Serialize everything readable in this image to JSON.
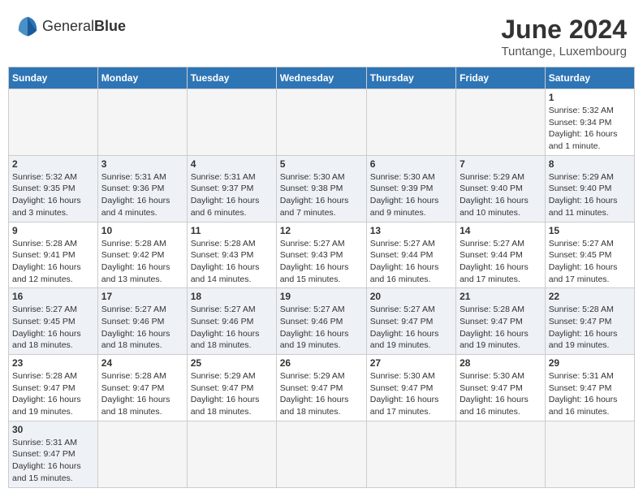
{
  "header": {
    "logo_text_normal": "General",
    "logo_text_bold": "Blue",
    "month_year": "June 2024",
    "location": "Tuntange, Luxembourg"
  },
  "weekdays": [
    "Sunday",
    "Monday",
    "Tuesday",
    "Wednesday",
    "Thursday",
    "Friday",
    "Saturday"
  ],
  "weeks": [
    {
      "days": [
        {
          "number": "",
          "info": "",
          "empty": true
        },
        {
          "number": "",
          "info": "",
          "empty": true
        },
        {
          "number": "",
          "info": "",
          "empty": true
        },
        {
          "number": "",
          "info": "",
          "empty": true
        },
        {
          "number": "",
          "info": "",
          "empty": true
        },
        {
          "number": "",
          "info": "",
          "empty": true
        },
        {
          "number": "1",
          "info": "Sunrise: 5:32 AM\nSunset: 9:34 PM\nDaylight: 16 hours\nand 1 minute."
        }
      ]
    },
    {
      "days": [
        {
          "number": "2",
          "info": "Sunrise: 5:32 AM\nSunset: 9:35 PM\nDaylight: 16 hours\nand 3 minutes."
        },
        {
          "number": "3",
          "info": "Sunrise: 5:31 AM\nSunset: 9:36 PM\nDaylight: 16 hours\nand 4 minutes."
        },
        {
          "number": "4",
          "info": "Sunrise: 5:31 AM\nSunset: 9:37 PM\nDaylight: 16 hours\nand 6 minutes."
        },
        {
          "number": "5",
          "info": "Sunrise: 5:30 AM\nSunset: 9:38 PM\nDaylight: 16 hours\nand 7 minutes."
        },
        {
          "number": "6",
          "info": "Sunrise: 5:30 AM\nSunset: 9:39 PM\nDaylight: 16 hours\nand 9 minutes."
        },
        {
          "number": "7",
          "info": "Sunrise: 5:29 AM\nSunset: 9:40 PM\nDaylight: 16 hours\nand 10 minutes."
        },
        {
          "number": "8",
          "info": "Sunrise: 5:29 AM\nSunset: 9:40 PM\nDaylight: 16 hours\nand 11 minutes."
        }
      ]
    },
    {
      "days": [
        {
          "number": "9",
          "info": "Sunrise: 5:28 AM\nSunset: 9:41 PM\nDaylight: 16 hours\nand 12 minutes."
        },
        {
          "number": "10",
          "info": "Sunrise: 5:28 AM\nSunset: 9:42 PM\nDaylight: 16 hours\nand 13 minutes."
        },
        {
          "number": "11",
          "info": "Sunrise: 5:28 AM\nSunset: 9:43 PM\nDaylight: 16 hours\nand 14 minutes."
        },
        {
          "number": "12",
          "info": "Sunrise: 5:27 AM\nSunset: 9:43 PM\nDaylight: 16 hours\nand 15 minutes."
        },
        {
          "number": "13",
          "info": "Sunrise: 5:27 AM\nSunset: 9:44 PM\nDaylight: 16 hours\nand 16 minutes."
        },
        {
          "number": "14",
          "info": "Sunrise: 5:27 AM\nSunset: 9:44 PM\nDaylight: 16 hours\nand 17 minutes."
        },
        {
          "number": "15",
          "info": "Sunrise: 5:27 AM\nSunset: 9:45 PM\nDaylight: 16 hours\nand 17 minutes."
        }
      ]
    },
    {
      "days": [
        {
          "number": "16",
          "info": "Sunrise: 5:27 AM\nSunset: 9:45 PM\nDaylight: 16 hours\nand 18 minutes."
        },
        {
          "number": "17",
          "info": "Sunrise: 5:27 AM\nSunset: 9:46 PM\nDaylight: 16 hours\nand 18 minutes."
        },
        {
          "number": "18",
          "info": "Sunrise: 5:27 AM\nSunset: 9:46 PM\nDaylight: 16 hours\nand 18 minutes."
        },
        {
          "number": "19",
          "info": "Sunrise: 5:27 AM\nSunset: 9:46 PM\nDaylight: 16 hours\nand 19 minutes."
        },
        {
          "number": "20",
          "info": "Sunrise: 5:27 AM\nSunset: 9:47 PM\nDaylight: 16 hours\nand 19 minutes."
        },
        {
          "number": "21",
          "info": "Sunrise: 5:28 AM\nSunset: 9:47 PM\nDaylight: 16 hours\nand 19 minutes."
        },
        {
          "number": "22",
          "info": "Sunrise: 5:28 AM\nSunset: 9:47 PM\nDaylight: 16 hours\nand 19 minutes."
        }
      ]
    },
    {
      "days": [
        {
          "number": "23",
          "info": "Sunrise: 5:28 AM\nSunset: 9:47 PM\nDaylight: 16 hours\nand 19 minutes."
        },
        {
          "number": "24",
          "info": "Sunrise: 5:28 AM\nSunset: 9:47 PM\nDaylight: 16 hours\nand 18 minutes."
        },
        {
          "number": "25",
          "info": "Sunrise: 5:29 AM\nSunset: 9:47 PM\nDaylight: 16 hours\nand 18 minutes."
        },
        {
          "number": "26",
          "info": "Sunrise: 5:29 AM\nSunset: 9:47 PM\nDaylight: 16 hours\nand 18 minutes."
        },
        {
          "number": "27",
          "info": "Sunrise: 5:30 AM\nSunset: 9:47 PM\nDaylight: 16 hours\nand 17 minutes."
        },
        {
          "number": "28",
          "info": "Sunrise: 5:30 AM\nSunset: 9:47 PM\nDaylight: 16 hours\nand 16 minutes."
        },
        {
          "number": "29",
          "info": "Sunrise: 5:31 AM\nSunset: 9:47 PM\nDaylight: 16 hours\nand 16 minutes."
        }
      ]
    },
    {
      "days": [
        {
          "number": "30",
          "info": "Sunrise: 5:31 AM\nSunset: 9:47 PM\nDaylight: 16 hours\nand 15 minutes."
        },
        {
          "number": "",
          "info": "",
          "empty": true
        },
        {
          "number": "",
          "info": "",
          "empty": true
        },
        {
          "number": "",
          "info": "",
          "empty": true
        },
        {
          "number": "",
          "info": "",
          "empty": true
        },
        {
          "number": "",
          "info": "",
          "empty": true
        },
        {
          "number": "",
          "info": "",
          "empty": true
        }
      ]
    }
  ]
}
